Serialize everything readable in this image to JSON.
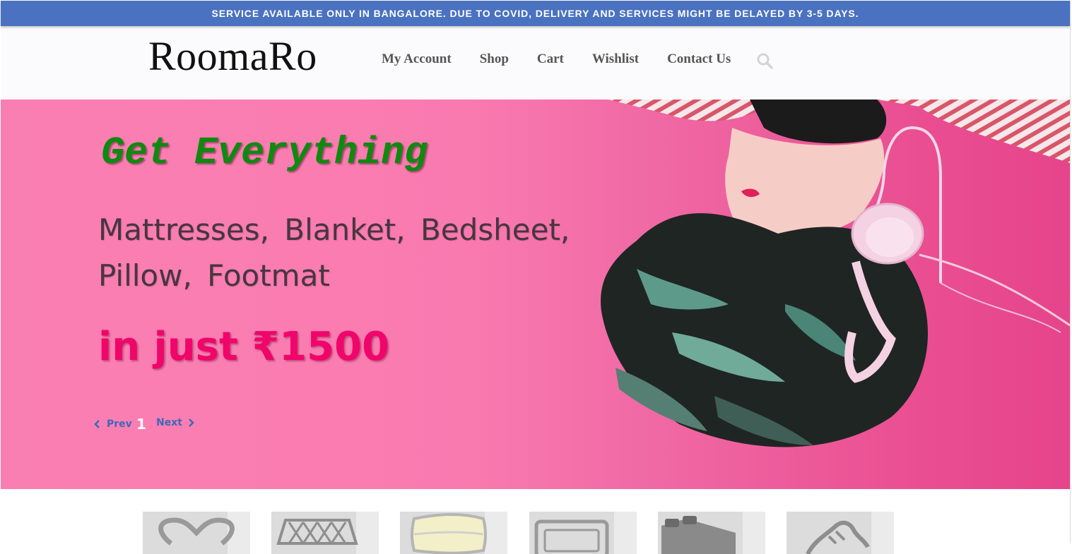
{
  "notice": "SERVICE AVAILABLE ONLY IN BANGALORE. DUE TO COVID, DELIVERY AND SERVICES MIGHT BE DELAYED BY 3-5 DAYS.",
  "header": {
    "logo": "RoomaRo",
    "nav": [
      {
        "label": "My Account"
      },
      {
        "label": "Shop"
      },
      {
        "label": "Cart"
      },
      {
        "label": "Wishlist"
      },
      {
        "label": "Contact Us"
      }
    ],
    "search_icon": "search-icon"
  },
  "hero": {
    "heading": "Get Everything",
    "items_line1": "Mattresses, Blanket, Bedsheet,",
    "items_line2": "Pillow, Footmat",
    "price": "in just ₹1500",
    "prev_label": "Prev",
    "next_label": "Next",
    "slide_counter": "1",
    "colors": {
      "background": "#f97db1",
      "heading": "#0e8a0e",
      "price": "#f0056a",
      "nav_link": "#3e68b8"
    }
  },
  "categories": [
    {
      "icon": "heart-icon"
    },
    {
      "icon": "mattress-icon"
    },
    {
      "icon": "pillow-icon"
    },
    {
      "icon": "frame-icon"
    },
    {
      "icon": "bedsheet-icon"
    },
    {
      "icon": "footmat-icon"
    }
  ],
  "colors": {
    "notice_bar": "#4a72c0"
  }
}
